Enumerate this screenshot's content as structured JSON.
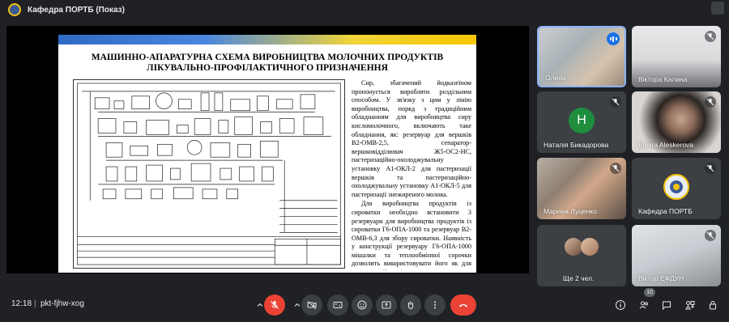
{
  "window": {
    "title": "Кафедра ПОРТБ (Показ)"
  },
  "slide": {
    "title_line1": "МАШИННО-АПАРАТУРНА СХЕМА ВИРОБНИЦТВА МОЛОЧНИХ ПРОДУКТІВ",
    "title_line2": "ЛІКУВАЛЬНО-ПРОФІЛАКТИЧНОГО ПРИЗНАЧЕННЯ",
    "paragraph1": "Сир, збагачений йодказеїном пропонується виробляти роздільним способом. У зв'язку з цим у лінію виробництва, поряд з традиційним обладнанням для виробництва сиру кисломолочного, включають таке обладнання, як: резервуар для вершків В2-ОМВ-2,5, сепаратор-вершковідділювач Ж5-ОС2-НС, пастеризаційно-охолоджувальну установку А1-ОКЛ-2 для пастеризації вершків та пастеризаційно-охолоджувальну установку А1-ОКЛ-5 для пастеризації знежиреного молока.",
    "paragraph2": "Для виробництва продуктів із сироватки необхідно встановити 3 резервуари для виробництва продуктів із сироватки Г6-ОПА-1000 та резервуар В2-ОМВ-6,3 для збору сироватки. Наявність у конструкції резервуару Г6-ОПА-1000 мішалки та теплообмінної сорочки дозволить використовувати його як для пастеризації, так і для охолодження"
  },
  "participants": [
    {
      "name": "Олена",
      "state": "speaking"
    },
    {
      "name": "Віктора Калина",
      "state": "muted"
    },
    {
      "name": "Наталія Бикадорова",
      "state": "muted",
      "initial": "Н",
      "avatar_color": "#1e8e3e"
    },
    {
      "name": "Elmira Aleskerova",
      "state": "muted"
    },
    {
      "name": "Марина Луценко",
      "state": "muted"
    },
    {
      "name": "Кафедра ПОРТБ",
      "state": "muted"
    },
    {
      "name": "Ще 2 чел.",
      "state": "group"
    },
    {
      "name": "Віктор ЕФДУН",
      "state": "muted"
    }
  ],
  "bottombar": {
    "time": "12:18",
    "separator": "|",
    "meeting_code": "pkt-fjhw-xog",
    "participant_count": "10"
  },
  "colors": {
    "end_call": "#ea4335",
    "control_bg": "#3c4043",
    "speaking": "#1a73e8"
  },
  "icons": [
    "chevron-up-icon",
    "mic-off-icon",
    "camera-off-icon",
    "captions-icon",
    "emoji-icon",
    "present-icon",
    "raise-hand-icon",
    "more-icon",
    "end-call-icon",
    "info-icon",
    "people-icon",
    "chat-icon",
    "activities-icon",
    "host-controls-icon"
  ]
}
